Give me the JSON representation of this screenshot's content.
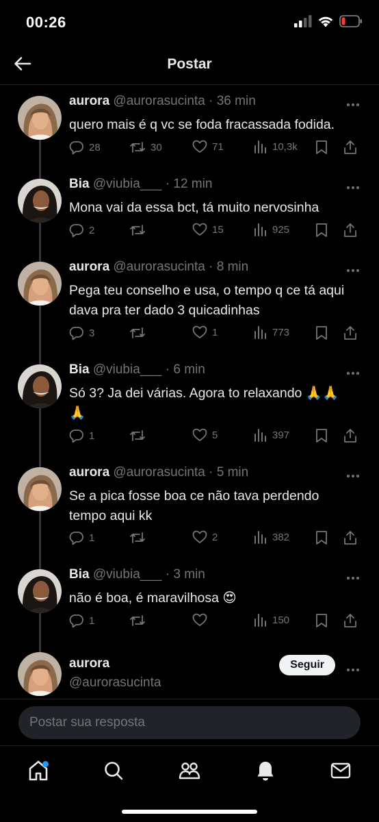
{
  "status_bar": {
    "time": "00:26"
  },
  "header": {
    "title": "Postar"
  },
  "tweets": [
    {
      "name": "aurora",
      "handle": "@aurorasucinta",
      "time": "36 min",
      "text": "quero mais é q vc se foda fracassada fodida.",
      "replies": "28",
      "retweets": "30",
      "likes": "71",
      "views": "10,3k"
    },
    {
      "name": "Bia",
      "handle": "@viubia___",
      "time": "12 min",
      "text": "Mona vai da essa bct, tá muito nervosinha",
      "replies": "2",
      "retweets": "",
      "likes": "15",
      "views": "925"
    },
    {
      "name": "aurora",
      "handle": "@aurorasucinta",
      "time": "8 min",
      "text": "Pega teu conselho e usa, o tempo q ce tá aqui dava pra ter dado 3 quicadinhas",
      "replies": "3",
      "retweets": "",
      "likes": "1",
      "views": "773"
    },
    {
      "name": "Bia",
      "handle": "@viubia___",
      "time": "6 min",
      "text": "Só 3? Ja dei várias. Agora to relaxando 🙏🙏🙏",
      "replies": "1",
      "retweets": "",
      "likes": "5",
      "views": "397"
    },
    {
      "name": "aurora",
      "handle": "@aurorasucinta",
      "time": "5 min",
      "text": "Se a pica fosse boa ce não tava perdendo tempo aqui kk",
      "replies": "1",
      "retweets": "",
      "likes": "2",
      "views": "382"
    },
    {
      "name": "Bia",
      "handle": "@viubia___",
      "time": "3 min",
      "text": "não é boa, é maravilhosa 😍",
      "replies": "1",
      "retweets": "",
      "likes": "",
      "views": "150"
    }
  ],
  "author_card": {
    "name": "aurora",
    "handle": "@aurorasucinta",
    "follow_label": "Seguir"
  },
  "reply": {
    "placeholder": "Postar sua resposta"
  },
  "tabs": [
    "home",
    "search",
    "communities",
    "notifications",
    "messages"
  ],
  "colors": {
    "background": "#000000",
    "text": "#e7e9ea",
    "muted": "#71767b",
    "accent": "#1d9bf0",
    "notch_battery": "#ff3b30"
  }
}
